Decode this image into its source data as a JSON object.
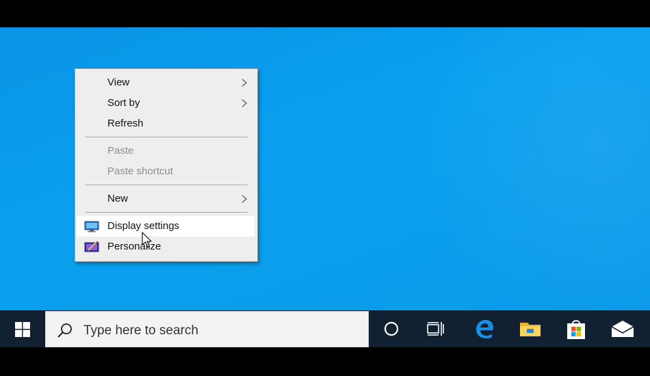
{
  "context_menu": {
    "items": [
      {
        "label": "View",
        "has_submenu": true,
        "enabled": true
      },
      {
        "label": "Sort by",
        "has_submenu": true,
        "enabled": true
      },
      {
        "label": "Refresh",
        "has_submenu": false,
        "enabled": true
      },
      {
        "label": "Paste",
        "has_submenu": false,
        "enabled": false
      },
      {
        "label": "Paste shortcut",
        "has_submenu": false,
        "enabled": false
      },
      {
        "label": "New",
        "has_submenu": true,
        "enabled": true
      },
      {
        "label": "Display settings",
        "icon": "display-settings-icon",
        "highlighted": true,
        "enabled": true
      },
      {
        "label": "Personalize",
        "icon": "personalize-icon",
        "enabled": true
      }
    ]
  },
  "taskbar": {
    "search_placeholder": "Type here to search",
    "icons": [
      "windows-logo-icon",
      "search-icon",
      "cortana-icon",
      "task-view-icon",
      "edge-icon",
      "file-explorer-icon",
      "store-icon",
      "mail-icon"
    ]
  },
  "colors": {
    "desktop": "#0aa0ef",
    "taskbar": "#122131",
    "menu_bg": "#eeeeee",
    "menu_highlight": "#ffffff",
    "disabled_text": "#8d8d8d"
  }
}
